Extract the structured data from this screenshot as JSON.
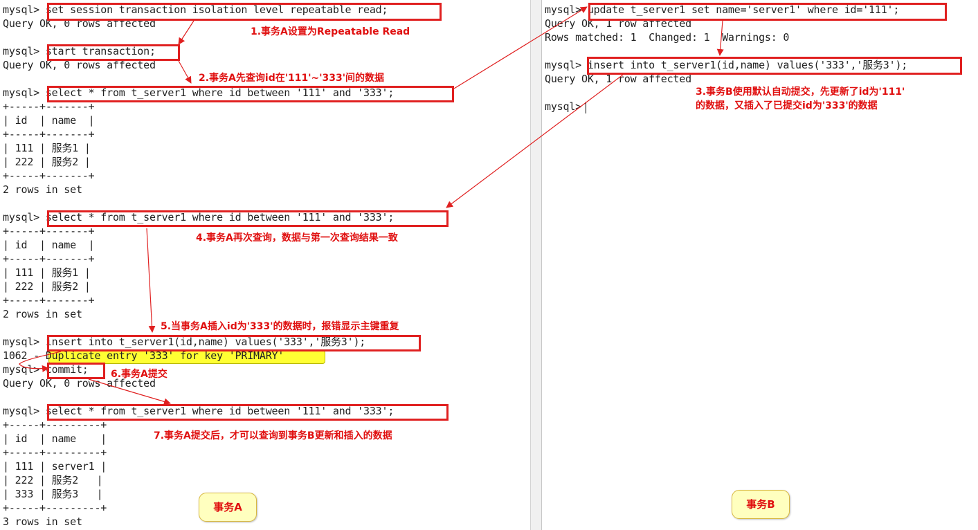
{
  "left": {
    "lines": [
      "mysql> set session transaction isolation level repeatable read;",
      "Query OK, 0 rows affected",
      "",
      "mysql> start transaction;",
      "Query OK, 0 rows affected",
      "",
      "mysql> select * from t_server1 where id between '111' and '333';",
      "+-----+-------+",
      "| id  | name  |",
      "+-----+-------+",
      "| 111 | 服务1 |",
      "| 222 | 服务2 |",
      "+-----+-------+",
      "2 rows in set",
      "",
      "mysql> select * from t_server1 where id between '111' and '333';",
      "+-----+-------+",
      "| id  | name  |",
      "+-----+-------+",
      "| 111 | 服务1 |",
      "| 222 | 服务2 |",
      "+-----+-------+",
      "2 rows in set",
      "",
      "mysql> insert into t_server1(id,name) values('333','服务3');",
      "1062 - Duplicate entry '333' for key 'PRIMARY'",
      "mysql> commit;",
      "Query OK, 0 rows affected",
      "",
      "mysql> select * from t_server1 where id between '111' and '333';",
      "+-----+---------+",
      "| id  | name    |",
      "+-----+---------+",
      "| 111 | server1 |",
      "| 222 | 服务2   |",
      "| 333 | 服务3   |",
      "+-----+---------+",
      "3 rows in set"
    ]
  },
  "right": {
    "lines": [
      "mysql> update t_server1 set name='server1' where id='111';",
      "Query OK, 1 row affected",
      "Rows matched: 1  Changed: 1  Warnings: 0",
      "",
      "mysql> insert into t_server1(id,name) values('333','服务3');",
      "Query OK, 1 row affected",
      "",
      "mysql> "
    ]
  },
  "annotations": {
    "a1": "1.事务A设置为Repeatable Read",
    "a2": "2.事务A先查询id在'111'~'333'间的数据",
    "a3_line1": "3.事务B使用默认自动提交，先更新了id为'111'",
    "a3_line2": "的数据，又插入了已提交id为'333'的数据",
    "a4": "4.事务A再次查询，数据与第一次查询结果一致",
    "a5": "5.当事务A插入id为'333'的数据时，报错显示主键重复",
    "a6": "6.事务A提交",
    "a7": "7.事务A提交后，才可以查询到事务B更新和插入的数据"
  },
  "labels": {
    "session_a": "事务A",
    "session_b": "事务B"
  },
  "colors": {
    "highlight_box": "#e02020",
    "annotation_text": "#e01010",
    "error_highlight": "#ffff33",
    "label_bg": "#ffffbf"
  }
}
